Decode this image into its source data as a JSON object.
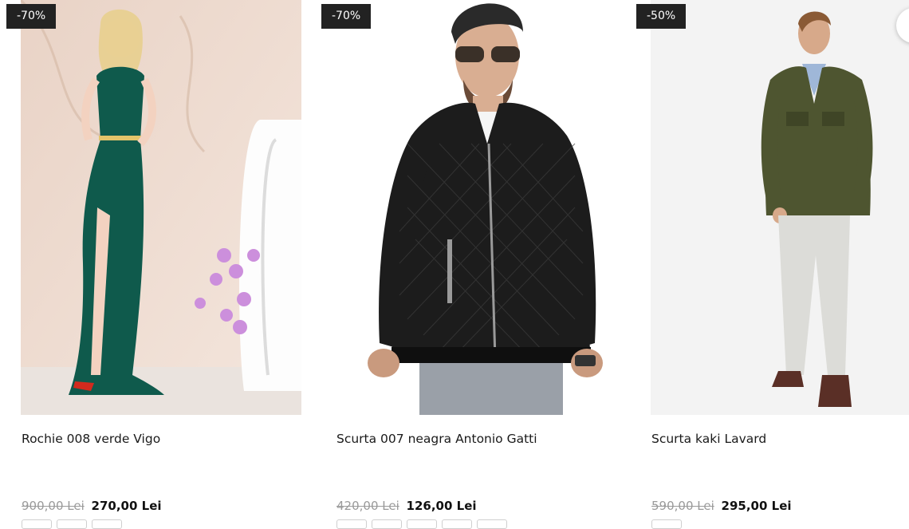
{
  "products": [
    {
      "badge": "-70%",
      "title": "Rochie 008 verde Vigo",
      "old_price": "900,00 Lei",
      "new_price": "270,00 Lei",
      "swatch_count": 3
    },
    {
      "badge": "-70%",
      "title": "Scurta 007 neagra Antonio Gatti",
      "old_price": "420,00 Lei",
      "new_price": "126,00 Lei",
      "swatch_count": 5
    },
    {
      "badge": "-50%",
      "title": "Scurta kaki Lavard",
      "old_price": "590,00 Lei",
      "new_price": "295,00 Lei",
      "swatch_count": 1
    }
  ],
  "colors": {
    "badge_bg": "#222222",
    "old_price": "#9a9a9a",
    "dress": "#0f5a4c",
    "jacket_black": "#1c1c1c",
    "jacket_khaki": "#4e5530"
  }
}
